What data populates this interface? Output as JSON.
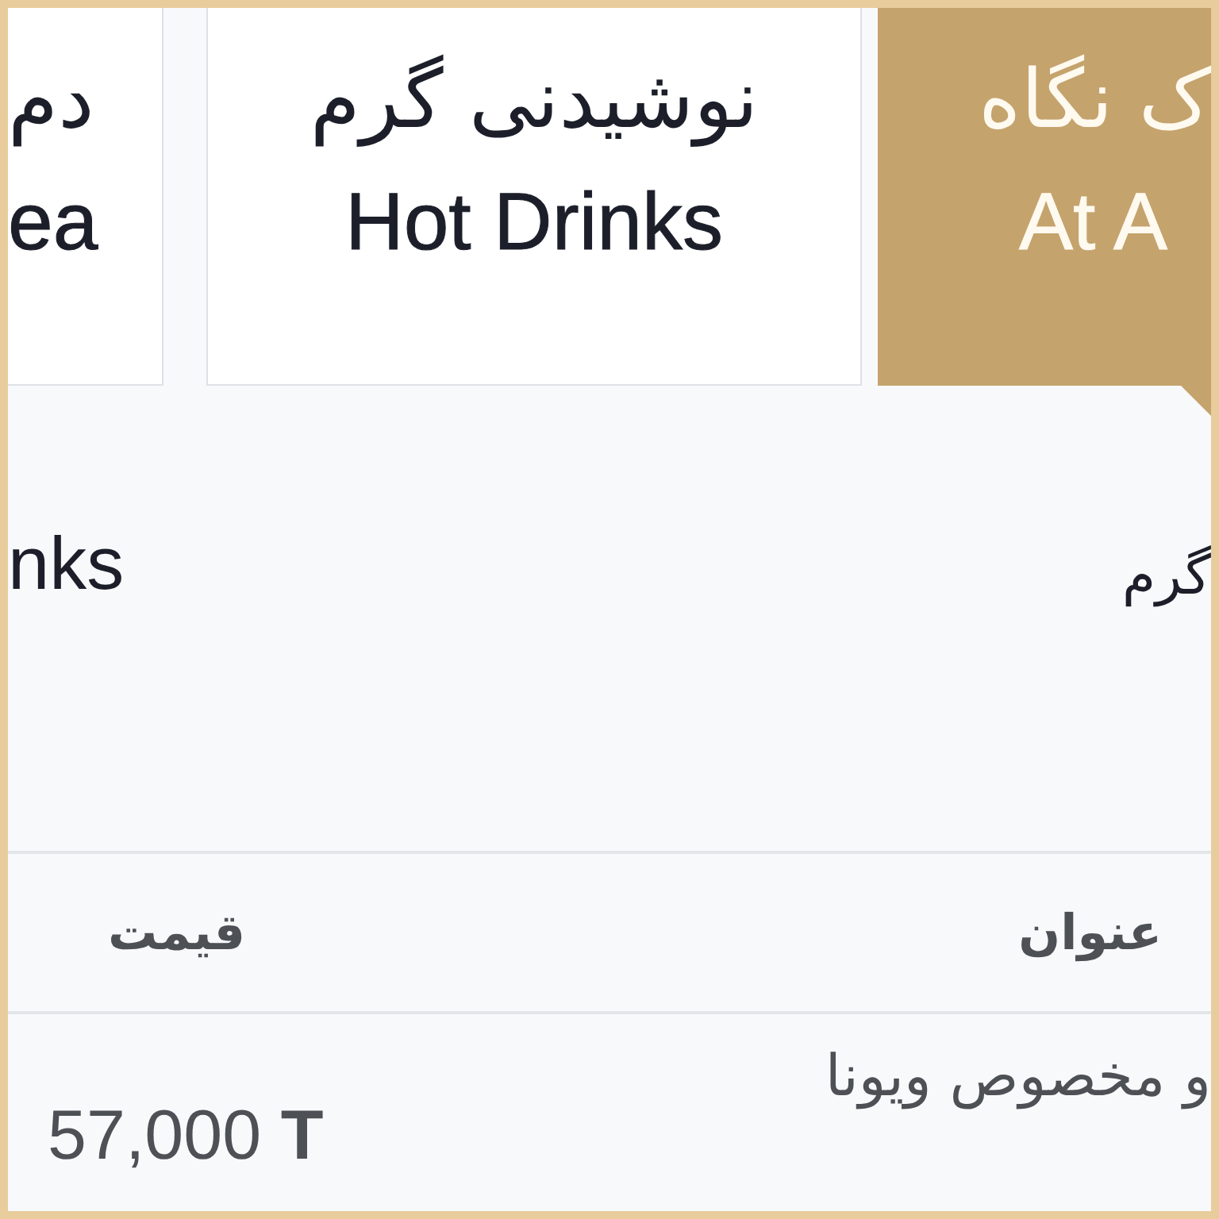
{
  "tabs": [
    {
      "title": "ک نگاه",
      "subtitle": "At A",
      "selected": true
    },
    {
      "title": "نوشیدنی گرم",
      "subtitle": "Hot Drinks",
      "selected": false
    },
    {
      "title": "دم",
      "subtitle": "ea",
      "selected": false
    }
  ],
  "section": {
    "title_fa": "گرم",
    "title_en": "nks"
  },
  "table": {
    "columns": {
      "title": "عنوان",
      "price": "قیمت"
    },
    "rows": [
      {
        "title": "و مخصوص ویونا",
        "price": "57,000 **T**"
      }
    ]
  }
}
